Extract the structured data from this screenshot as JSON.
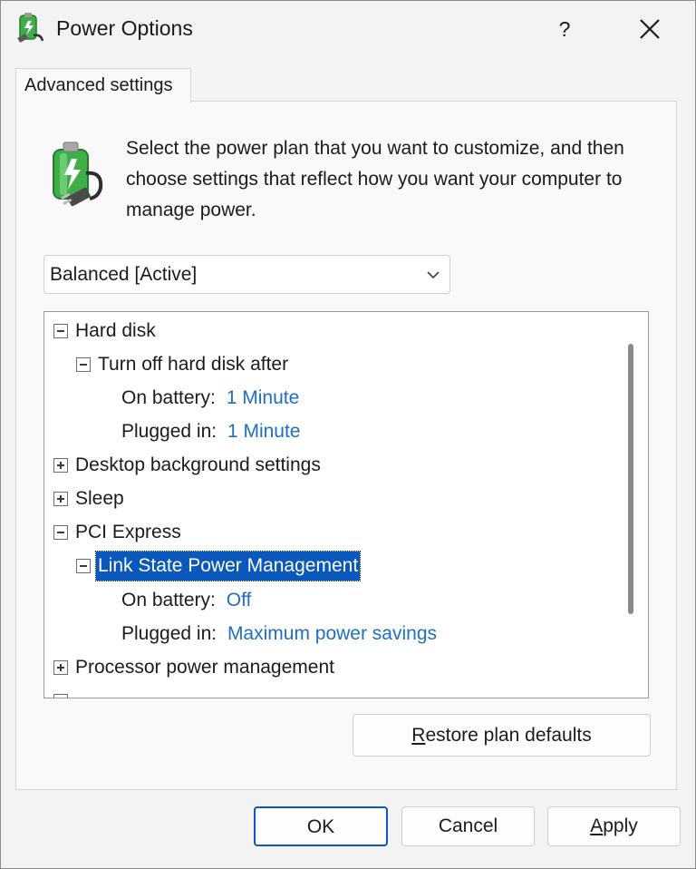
{
  "window": {
    "title": "Power Options",
    "help_label": "?"
  },
  "tab": {
    "label": "Advanced settings"
  },
  "intro_text": "Select the power plan that you want to customize, and then choose settings that reflect how you want your computer to manage power.",
  "plan_select": {
    "selected": "Balanced [Active]"
  },
  "tree": [
    {
      "label": "Hard disk",
      "expander": "minus"
    },
    {
      "label": "Turn off hard disk after",
      "expander": "minus"
    },
    {
      "label": "On battery:",
      "value": "1 Minute"
    },
    {
      "label": "Plugged in:",
      "value": "1 Minute"
    },
    {
      "label": "Desktop background settings",
      "expander": "plus"
    },
    {
      "label": "Sleep",
      "expander": "plus"
    },
    {
      "label": "PCI Express",
      "expander": "minus"
    },
    {
      "label": "Link State Power Management",
      "expander": "minus",
      "selected": true
    },
    {
      "label": "On battery:",
      "value": "Off"
    },
    {
      "label": "Plugged in:",
      "value": "Maximum power savings"
    },
    {
      "label": "Processor power management",
      "expander": "plus"
    }
  ],
  "buttons": {
    "restore_mnemonic": "R",
    "restore_rest": "estore plan defaults",
    "ok": "OK",
    "cancel": "Cancel",
    "apply_mnemonic": "A",
    "apply_rest": "pply"
  },
  "colors": {
    "value_link": "#1f6fc0",
    "selection": "#0b58bd",
    "battery_green": "#3fae49"
  },
  "icons": [
    "power-options-icon",
    "help-icon",
    "close-icon",
    "battery-plug-icon",
    "chevron-down-icon",
    "collapse-icon",
    "expand-icon"
  ]
}
